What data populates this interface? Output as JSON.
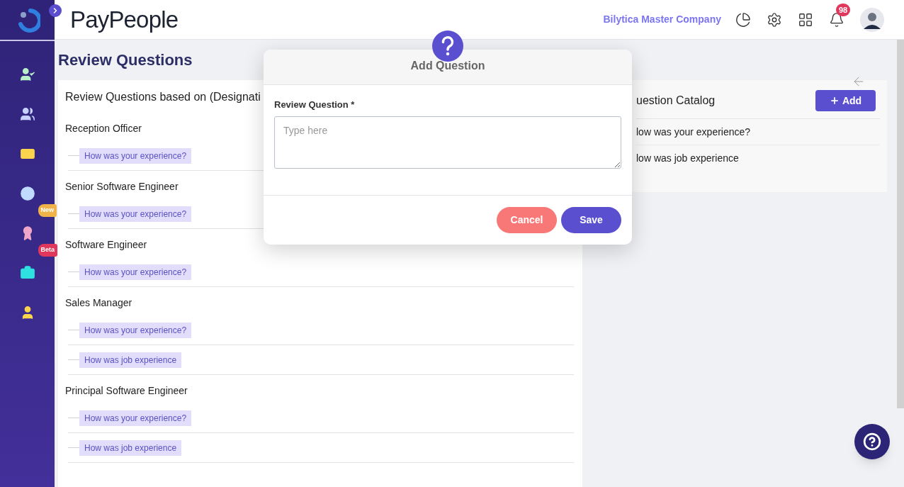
{
  "header": {
    "logo": "PayPeople",
    "company": "Bilytica Master Company",
    "notification_count": "98"
  },
  "sidebar": {
    "items": [
      {
        "kind": "attendance"
      },
      {
        "kind": "team"
      },
      {
        "kind": "payroll"
      },
      {
        "kind": "timesheet"
      },
      {
        "kind": "appraisal",
        "badge": {
          "label": "New",
          "color": "#f0b34a"
        }
      },
      {
        "kind": "recruitment",
        "badge": {
          "label": "Beta",
          "color": "#e0385c"
        }
      },
      {
        "kind": "profile"
      }
    ]
  },
  "page_title": "Review Questions",
  "designations_card": {
    "title": "Review Questions based on (Designati",
    "groups": [
      {
        "designation": "Reception Officer",
        "questions": [
          "How was your experience?"
        ]
      },
      {
        "designation": "Senior Software Engineer",
        "questions": [
          "How was your experience?"
        ]
      },
      {
        "designation": "Software Engineer",
        "questions": [
          "How was your experience?"
        ]
      },
      {
        "designation": "Sales Manager",
        "questions": [
          "How was your experience?",
          "How was job experience"
        ]
      },
      {
        "designation": "Principal Software Engineer",
        "questions": [
          "How was your experience?",
          "How was job experience"
        ]
      }
    ]
  },
  "catalog_card": {
    "title": "uestion Catalog",
    "add_button": "Add",
    "items": [
      "low was your experience?",
      "low was job experience"
    ]
  },
  "modal": {
    "title": "Add Question",
    "field_label": "Review Question *",
    "placeholder": "Type here",
    "buttons": [
      "Cancel",
      "Save"
    ]
  }
}
